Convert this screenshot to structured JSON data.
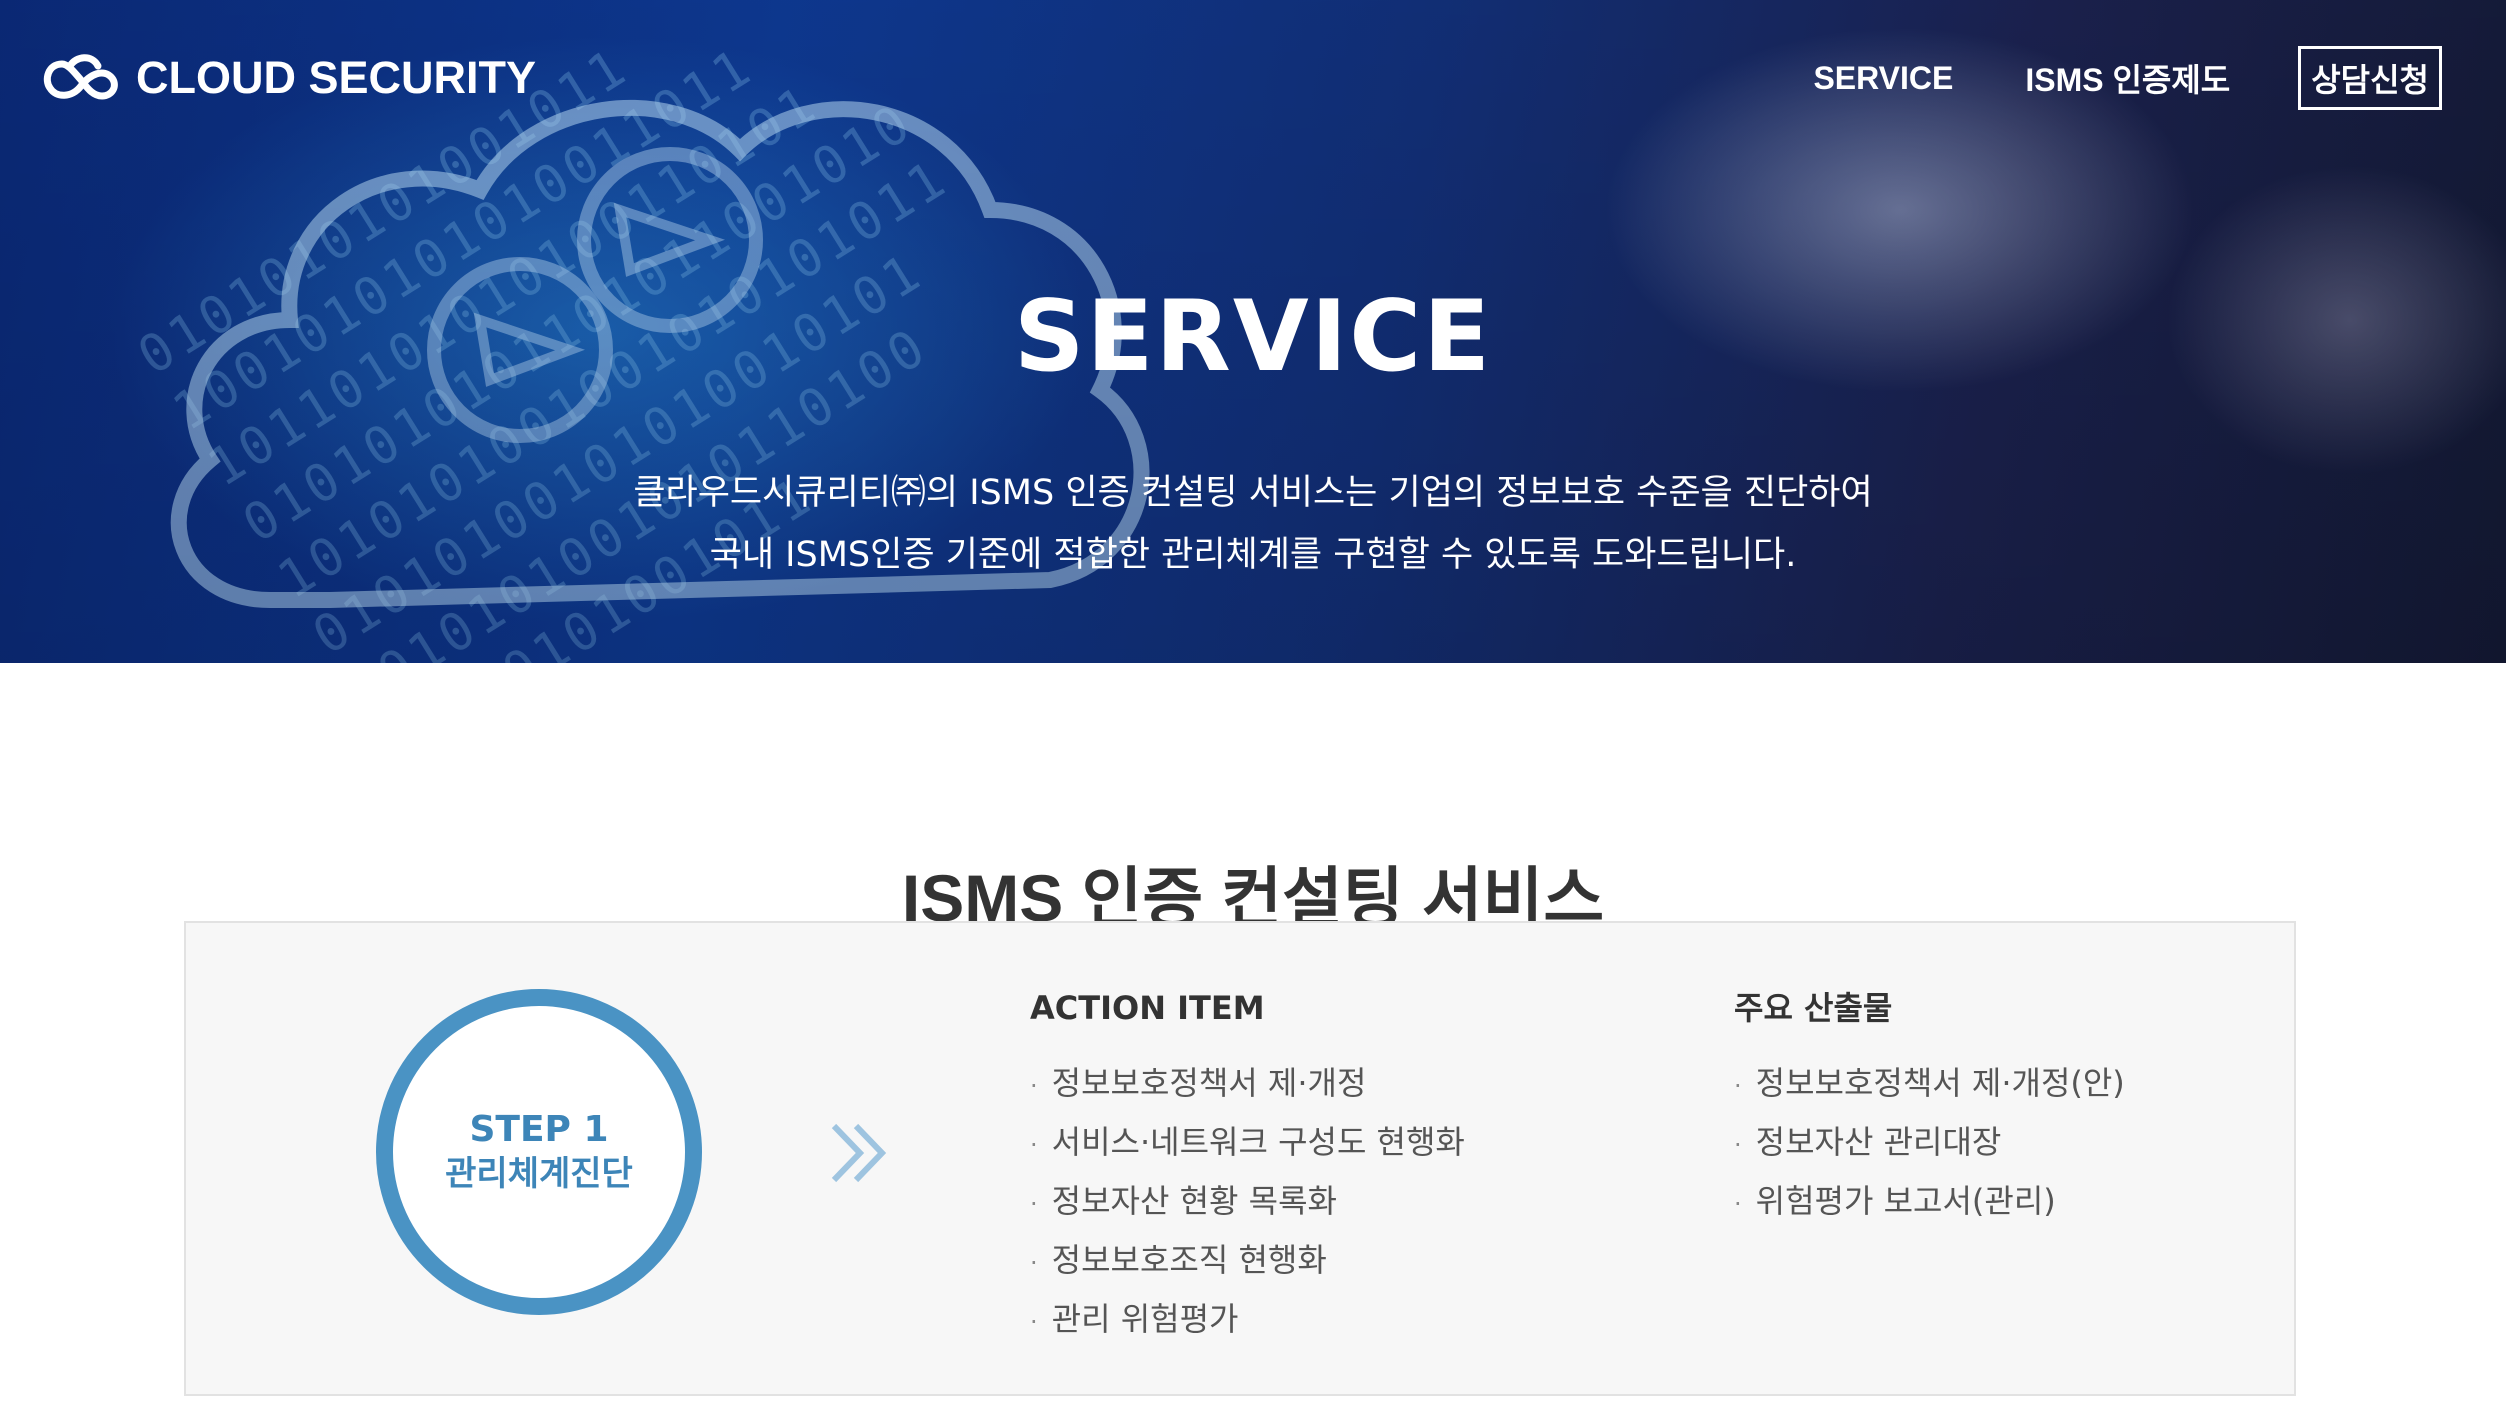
{
  "header": {
    "logo_text": "CLOUD SECURITY",
    "logo_icon": "cloud-infinity-icon",
    "nav": [
      {
        "label": "SERVICE"
      },
      {
        "label": "ISMS 인증제도"
      },
      {
        "label": "상담신청"
      }
    ]
  },
  "hero": {
    "title": "SERVICE",
    "description_line1": "클라우드시큐리티㈜의 ISMS 인증 컨설팅 서비스는 기업의 정보보호 수준을 진단하여",
    "description_line2": "국내 ISMS인증 기준에 적합한 관리체계를 구현할 수 있도록 도와드립니다."
  },
  "section": {
    "title": "ISMS 인증 컨설팅 서비스",
    "step": {
      "number": "STEP 1",
      "name": "관리체계진단",
      "accent_color": "#4a93c4"
    },
    "arrow_icon": "double-chevron-right-icon",
    "action_item": {
      "heading": "ACTION ITEM",
      "items": [
        "정보보호정책서 제·개정",
        "서비스·네트워크 구성도 현행화",
        "정보자산 현황 목록화",
        "정보보호조직 현행화",
        "관리 위험평가"
      ]
    },
    "outputs": {
      "heading": "주요 산출물",
      "items": [
        "정보보호정책서 제·개정(안)",
        "정보자산 관리대장",
        "위험평가 보고서(관리)"
      ]
    },
    "bullet": "·"
  }
}
